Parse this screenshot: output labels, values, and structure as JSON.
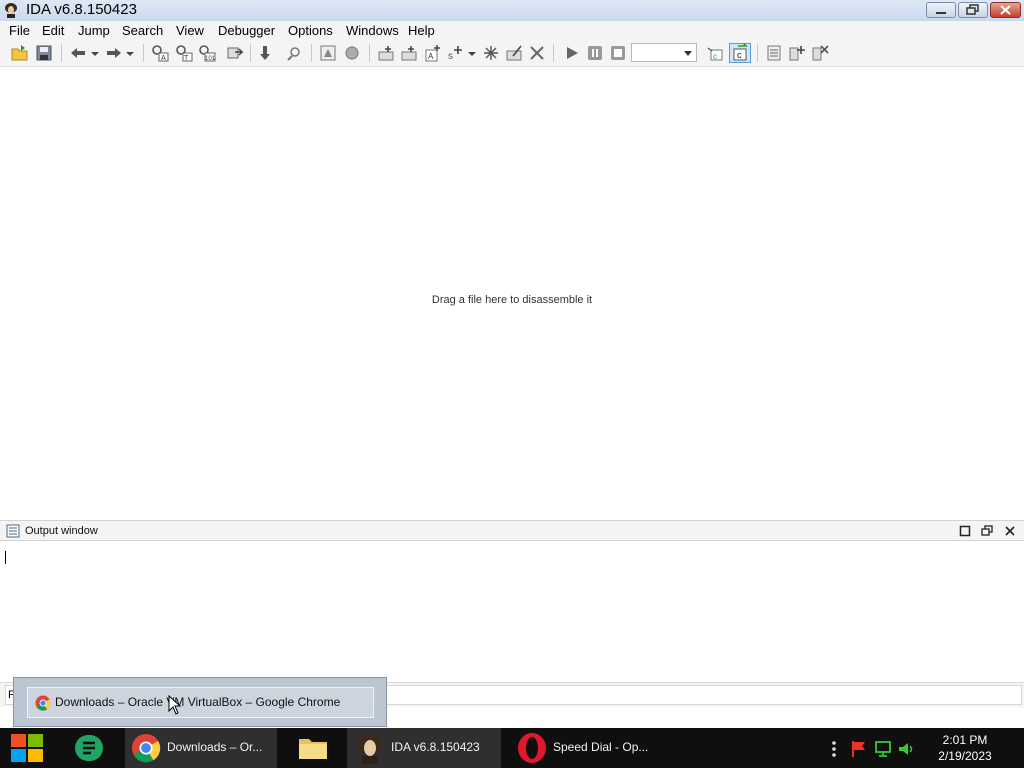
{
  "window": {
    "title": "IDA v6.8.150423",
    "app_icon": "ida-portrait-icon"
  },
  "menu": [
    "File",
    "Edit",
    "Jump",
    "Search",
    "View",
    "Debugger",
    "Options",
    "Windows",
    "Help"
  ],
  "toolbar": {
    "debugger_combo_value": "",
    "icons": [
      "open-file-icon",
      "save-icon",
      "back-arrow-icon",
      "forward-arrow-icon",
      "text-search-icon",
      "binary-search-icon",
      "immediate-search-icon",
      "jump-icon",
      "down-arrow-icon",
      "cross-ref-icon",
      "graph-icon",
      "circle-icon",
      "make-code-icon",
      "make-data-icon",
      "make-ascii-icon",
      "make-array-icon",
      "undefine-icon",
      "name-icon",
      "delete-icon",
      "start-process-icon",
      "pause-process-icon",
      "stop-process-icon",
      "debugger-option-icon",
      "cfg-toggle-icon",
      "struct-icon",
      "add-struct-icon",
      "delete-struct-icon"
    ]
  },
  "main": {
    "hint": "Drag a file here to disassemble it"
  },
  "output_window": {
    "title": "Output window",
    "command_prefix": "P"
  },
  "thumbnail_popup": {
    "label": "Downloads – Oracle VM VirtualBox – Google Chrome"
  },
  "taskbar": {
    "items": [
      {
        "label": "Downloads – Or...",
        "icon": "chrome-icon"
      },
      {
        "label": "",
        "icon": "file-explorer-icon"
      },
      {
        "label": "IDA v6.8.150423",
        "icon": "ida-icon"
      },
      {
        "label": "Speed Dial - Op...",
        "icon": "opera-icon"
      }
    ],
    "clock": {
      "time": "2:01 PM",
      "date": "2/19/2023"
    }
  },
  "colors": {
    "taskbar": "#0f0f0f",
    "titlebar": "#c9d9ee",
    "close_button": "#c4402b",
    "opera_red": "#e0182d",
    "sheets_green": "#1fa463"
  }
}
